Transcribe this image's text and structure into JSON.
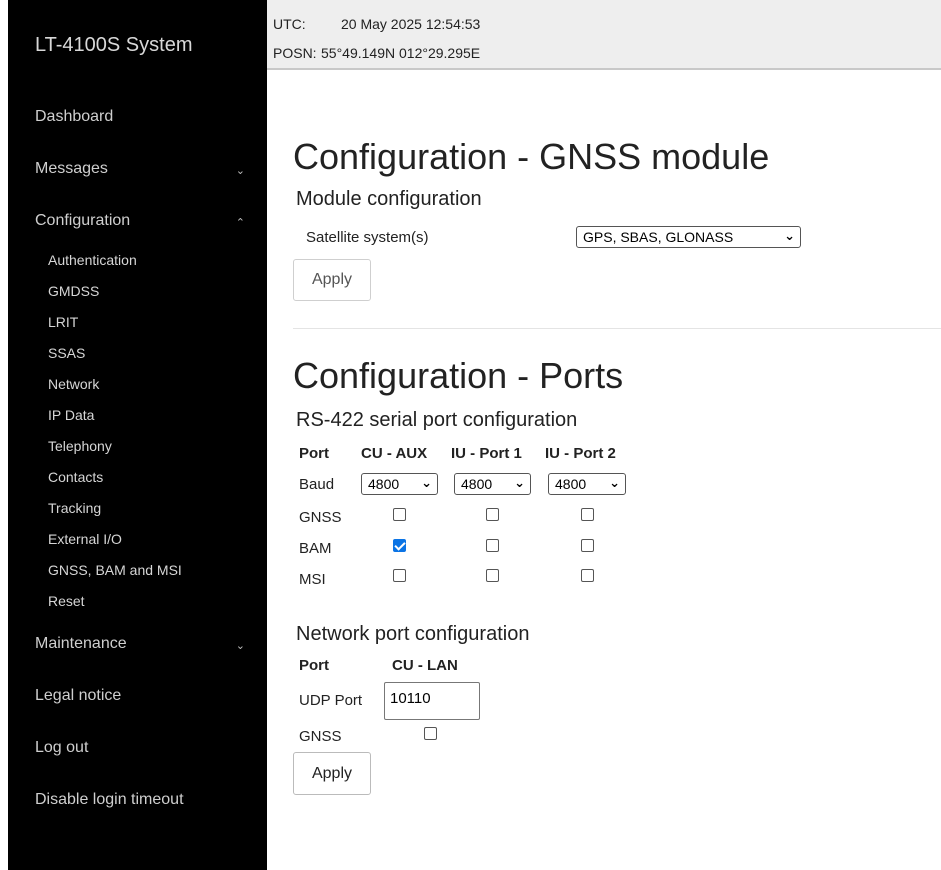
{
  "app": {
    "title": "LT-4100S System"
  },
  "status": {
    "utc_label": "UTC:",
    "utc_value": "20 May 2025 12:54:53",
    "posn_label": "POSN:",
    "posn_value": "55°49.149N 012°29.295E"
  },
  "sidebar": {
    "dashboard": "Dashboard",
    "messages": "Messages",
    "configuration": "Configuration",
    "config_items": [
      "Authentication",
      "GMDSS",
      "LRIT",
      "SSAS",
      "Network",
      "IP Data",
      "Telephony",
      "Contacts",
      "Tracking",
      "External I/O",
      "GNSS, BAM and MSI",
      "Reset"
    ],
    "maintenance": "Maintenance",
    "legal": "Legal notice",
    "logout": "Log out",
    "disable_timeout": "Disable login timeout"
  },
  "gnss": {
    "title": "Configuration - GNSS module",
    "subtitle": "Module configuration",
    "satellite_label": "Satellite system(s)",
    "satellite_value": "GPS, SBAS, GLONASS",
    "apply_label": "Apply"
  },
  "ports": {
    "title": "Configuration - Ports",
    "serial_title": "RS-422 serial port configuration",
    "header_port": "Port",
    "columns": [
      "CU - AUX",
      "IU - Port 1",
      "IU - Port 2"
    ],
    "baud_label": "Baud",
    "baud_values": [
      "4800",
      "4800",
      "4800"
    ],
    "rows": [
      {
        "label": "GNSS",
        "checked": [
          false,
          false,
          false
        ]
      },
      {
        "label": "BAM",
        "checked": [
          true,
          false,
          false
        ]
      },
      {
        "label": "MSI",
        "checked": [
          false,
          false,
          false
        ]
      }
    ],
    "network_title": "Network port configuration",
    "net_header_port": "Port",
    "net_column": "CU - LAN",
    "udp_label": "UDP Port",
    "udp_value": "10110",
    "net_gnss_label": "GNSS",
    "net_gnss_checked": false,
    "apply_label": "Apply"
  },
  "colors": {
    "sidebar_bg": "#000000",
    "topbar_bg": "#eeeeee",
    "checkbox_accent": "#0b74e5"
  }
}
